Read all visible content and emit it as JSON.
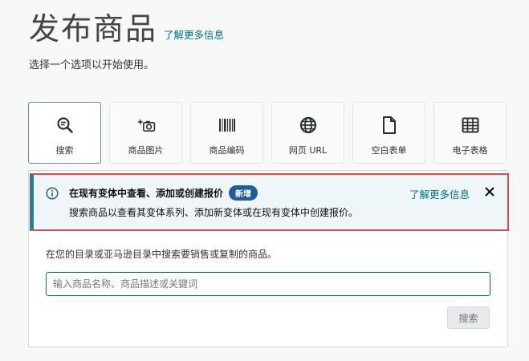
{
  "header": {
    "title": "发布商品",
    "learn_more": "了解更多信息",
    "subtitle": "选择一个选项以开始使用。"
  },
  "options": [
    {
      "label": "搜索",
      "icon": "search-icon",
      "selected": true
    },
    {
      "label": "商品图片",
      "icon": "camera-sparkle-icon",
      "selected": false
    },
    {
      "label": "商品编码",
      "icon": "barcode-icon",
      "selected": false
    },
    {
      "label": "网页 URL",
      "icon": "globe-icon",
      "selected": false
    },
    {
      "label": "空白表单",
      "icon": "blank-document-icon",
      "selected": false
    },
    {
      "label": "电子表格",
      "icon": "spreadsheet-icon",
      "selected": false
    }
  ],
  "alert": {
    "title": "在现有变体中查看、添加或创建报价",
    "badge": "新增",
    "body": "搜索商品以查看其变体系列、添加新变体或在现有变体中创建报价。",
    "learn_more": "了解更多信息"
  },
  "search": {
    "prompt": "在您的目录或亚马逊目录中搜索要销售或复制的商品。",
    "placeholder": "输入商品名称、商品描述或关键词",
    "value": "",
    "button_label": "搜索"
  },
  "colors": {
    "accent": "#007185",
    "badge": "#1f5c99",
    "highlight_border": "#e0464d",
    "alert_bg": "#eef6f9"
  }
}
